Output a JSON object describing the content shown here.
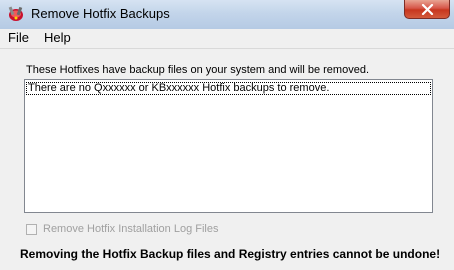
{
  "window": {
    "title": "Remove Hotfix Backups"
  },
  "menu": {
    "items": [
      "File",
      "Help"
    ]
  },
  "main": {
    "description": "These Hotfixes have backup files on your system and will be removed.",
    "list_items": [
      "There are no Qxxxxxx or KBxxxxxx Hotfix backups to remove."
    ],
    "checkbox": {
      "label": "Remove Hotfix Installation Log Files",
      "checked": false,
      "enabled": false
    },
    "warning": "Removing the Hotfix Backup files and Registry entries cannot be undone!"
  },
  "icons": {
    "app": "hotfix-app-icon",
    "close": "close-icon"
  },
  "colors": {
    "titlebar": "#c3d5ea",
    "close_button": "#c7361f",
    "disabled_text": "#a0a0a0"
  }
}
